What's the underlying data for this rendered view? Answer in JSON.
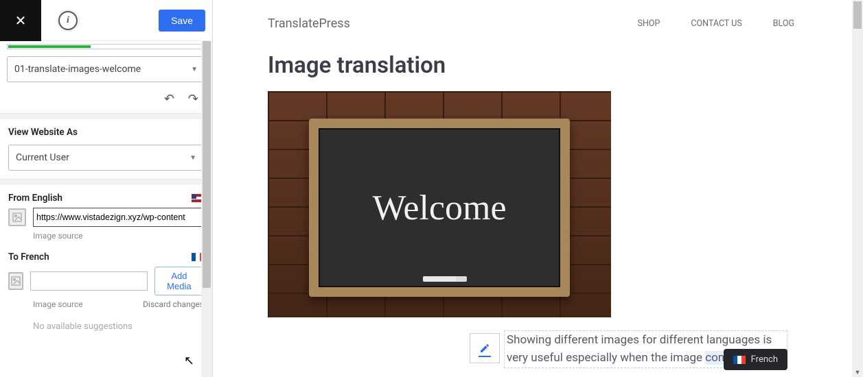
{
  "toolbar": {
    "save_label": "Save"
  },
  "string_selector": {
    "value": "01-translate-images-welcome"
  },
  "view_as": {
    "label": "View Website As",
    "value": "Current User"
  },
  "from": {
    "label": "From English",
    "url": "https://www.vistadezign.xyz/wp-content",
    "hint": "Image source"
  },
  "to": {
    "label": "To French",
    "hint": "Image source",
    "add_media": "Add Media",
    "discard": "Discard changes",
    "no_suggestions": "No available suggestions"
  },
  "site": {
    "brand": "TranslatePress",
    "nav": [
      "SHOP",
      "CONTACT US",
      "BLOG"
    ],
    "title": "Image translation",
    "hero_text": "Welcome",
    "caption_a": "Showing different images for different languages is very useful especially when the image ",
    "caption_b": "contains text."
  },
  "lang_switch": "French"
}
